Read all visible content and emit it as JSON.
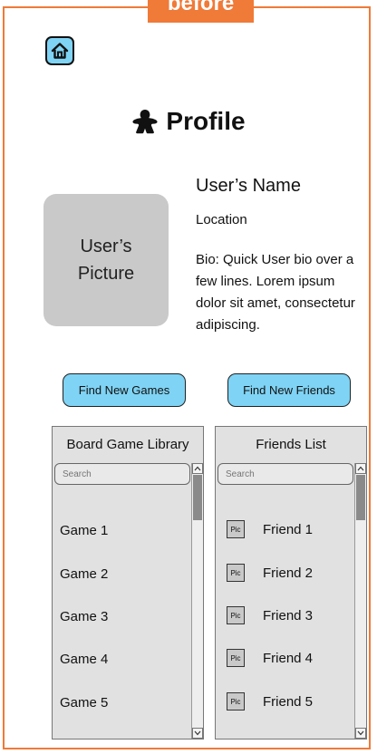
{
  "frame": {
    "label": "before",
    "border_color": "#f07a38"
  },
  "home_button": {
    "icon": "home-icon",
    "color": "#7fd3f4"
  },
  "header": {
    "title": "Profile",
    "icon": "meeple-icon"
  },
  "profile": {
    "picture_label_line1": "User’s",
    "picture_label_line2": "Picture",
    "name": "User’s Name",
    "location": "Location",
    "bio": "Bio: Quick User bio over a few lines. Lorem ipsum dolor sit amet, consectetur adipiscing."
  },
  "actions": {
    "find_games_label": "Find New Games",
    "find_friends_label": "Find New Friends",
    "button_color": "#7fd3f4"
  },
  "library": {
    "title": "Board Game Library",
    "search_placeholder": "Search",
    "items": [
      "Game 1",
      "Game 2",
      "Game 3",
      "Game 4",
      "Game 5"
    ]
  },
  "friends": {
    "title": "Friends List",
    "search_placeholder": "Search",
    "pic_label": "Pic",
    "items": [
      "Friend 1",
      "Friend 2",
      "Friend 3",
      "Friend 4",
      "Friend 5"
    ]
  }
}
